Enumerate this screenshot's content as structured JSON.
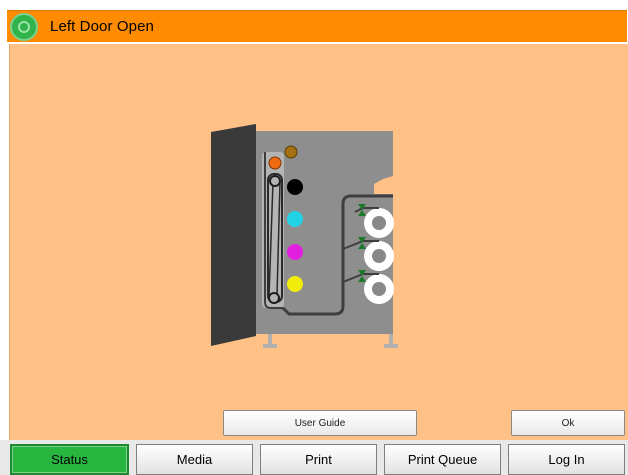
{
  "titlebar": {
    "title": "Left Door Open",
    "status_icon": "status-ok-icon",
    "color": "#ff8c00"
  },
  "content": {
    "background": "#ffc185",
    "illustration": "printer-left-door-open-diagram"
  },
  "buttons": {
    "user_guide": "User Guide",
    "ok": "Ok"
  },
  "nav": {
    "tabs": [
      {
        "label": "Status",
        "active": true
      },
      {
        "label": "Media",
        "active": false
      },
      {
        "label": "Print",
        "active": false
      },
      {
        "label": "Print Queue",
        "active": false
      },
      {
        "label": "Log In",
        "active": false
      }
    ]
  },
  "colors": {
    "active_tab": "#28b540",
    "toner_k": "#000000",
    "toner_c": "#22d3e6",
    "toner_m": "#e21fe0",
    "toner_y": "#f2ec0a"
  }
}
